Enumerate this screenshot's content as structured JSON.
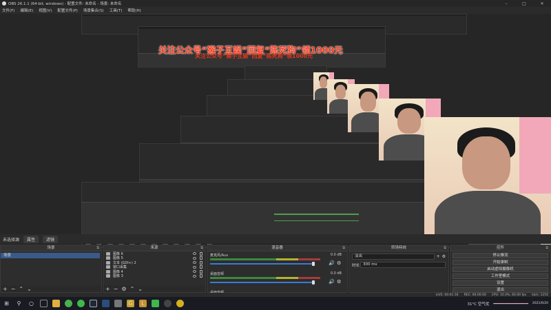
{
  "window": {
    "title": "OBS 26.1.1 (64-bit, windows) - 配置文件: 未命名 - 场景: 未命名",
    "controls": [
      "minimize-icon",
      "maximize-icon",
      "close-icon"
    ]
  },
  "menu": [
    "文件(F)",
    "编辑(E)",
    "视图(V)",
    "配置文件(P)",
    "场景集合(S)",
    "工具(T)",
    "帮助(H)"
  ],
  "overlay": {
    "banner": "关注公众号“猴子互娱”回复“陈死狗”领1000元",
    "banner_echo": "关注公众号“猴子互娱”回复“陈死狗”领1000元"
  },
  "midbar": {
    "label": "未选择源",
    "tabs": [
      "属性",
      "滤镜"
    ]
  },
  "scenes": {
    "title": "场景",
    "items": [
      "场景"
    ]
  },
  "sources": {
    "title": "来源",
    "items": [
      "图像 6",
      "图像 5",
      "文本 (GDI+) 2",
      "窗口采集",
      "图像 4",
      "图像 3"
    ]
  },
  "mixer": {
    "title": "混音器",
    "channels": [
      {
        "name": "麦克风/Aux",
        "db": "0.0 dB",
        "level": 0.72,
        "volume": 0.9
      },
      {
        "name": "桌面音频",
        "db": "0.0 dB",
        "level": 0.55,
        "volume": 0.9
      },
      {
        "name": "桌面音频",
        "db": "",
        "level": 0.0,
        "volume": 0.0
      }
    ]
  },
  "transitions": {
    "title": "转场特效",
    "type": "淡出",
    "duration_label": "时长",
    "duration": "300 ms"
  },
  "controls": {
    "title": "控件",
    "buttons": [
      "停止推流",
      "开始录制",
      "启动虚拟摄像机",
      "工作室模式",
      "设置",
      "退出"
    ]
  },
  "status": {
    "live": "LIVE: 00:01:34",
    "rec": "REC: 00:00:00",
    "cpu": "CPU: 10.4%, 60.00 fps",
    "extra": "kb/s: 1254"
  },
  "taskbar": {
    "icons": [
      "windows-icon",
      "search-icon",
      "cortana-icon",
      "taskview-icon",
      "explorer-icon",
      "chrome-icon",
      "wechat-icon",
      "steam-icon",
      "monitor-icon",
      "game-icon",
      "gg-icon",
      "l-icon",
      "shield-icon",
      "obs-icon",
      "yellow-icon"
    ],
    "weather": "31°C 空气优",
    "time": "",
    "date": "2021/6/20"
  },
  "colors": {
    "accent": "#3c7ad8",
    "meter_green": "#3c8a3c",
    "banner": "#ff3a1a"
  }
}
